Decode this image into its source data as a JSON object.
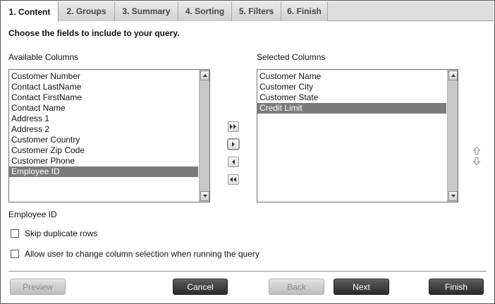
{
  "tabs": [
    {
      "label": "1. Content",
      "active": true
    },
    {
      "label": "2. Groups",
      "active": false
    },
    {
      "label": "3. Summary",
      "active": false
    },
    {
      "label": "4. Sorting",
      "active": false
    },
    {
      "label": "5. Filters",
      "active": false
    },
    {
      "label": "6. Finish",
      "active": false
    }
  ],
  "instruction": "Choose the fields to include to your query.",
  "available": {
    "label": "Available Columns",
    "items": [
      "Customer Number",
      "Contact LastName",
      "Contact FirstName",
      "Contact Name",
      "Address 1",
      "Address 2",
      "Customer Country",
      "Customer Zip Code",
      "Customer Phone",
      "Employee ID"
    ],
    "selected_item": "Employee ID"
  },
  "selected": {
    "label": "Selected Columns",
    "items": [
      "Customer Name",
      "Customer City",
      "Customer State",
      "Credit Limit"
    ],
    "selected_item": "Credit Limit"
  },
  "move_buttons": {
    "add_all_icon": "double-right-arrow-icon",
    "add_icon": "right-arrow-icon",
    "remove_icon": "left-arrow-icon",
    "remove_all_icon": "double-left-arrow-icon"
  },
  "order_buttons": {
    "up_icon": "move-up-arrow-icon",
    "down_icon": "move-down-arrow-icon"
  },
  "current_field": "Employee ID",
  "options": [
    {
      "label": "Skip duplicate rows",
      "checked": false
    },
    {
      "label": "Allow user to change column selection when running the query",
      "checked": false
    }
  ],
  "buttons": {
    "preview": "Preview",
    "cancel": "Cancel",
    "back": "Back",
    "next": "Next",
    "finish": "Finish"
  },
  "colors": {
    "selection": "#7b7b7b",
    "dark_button": "#3a3a3a",
    "disabled_button": "#d0d0d0"
  }
}
